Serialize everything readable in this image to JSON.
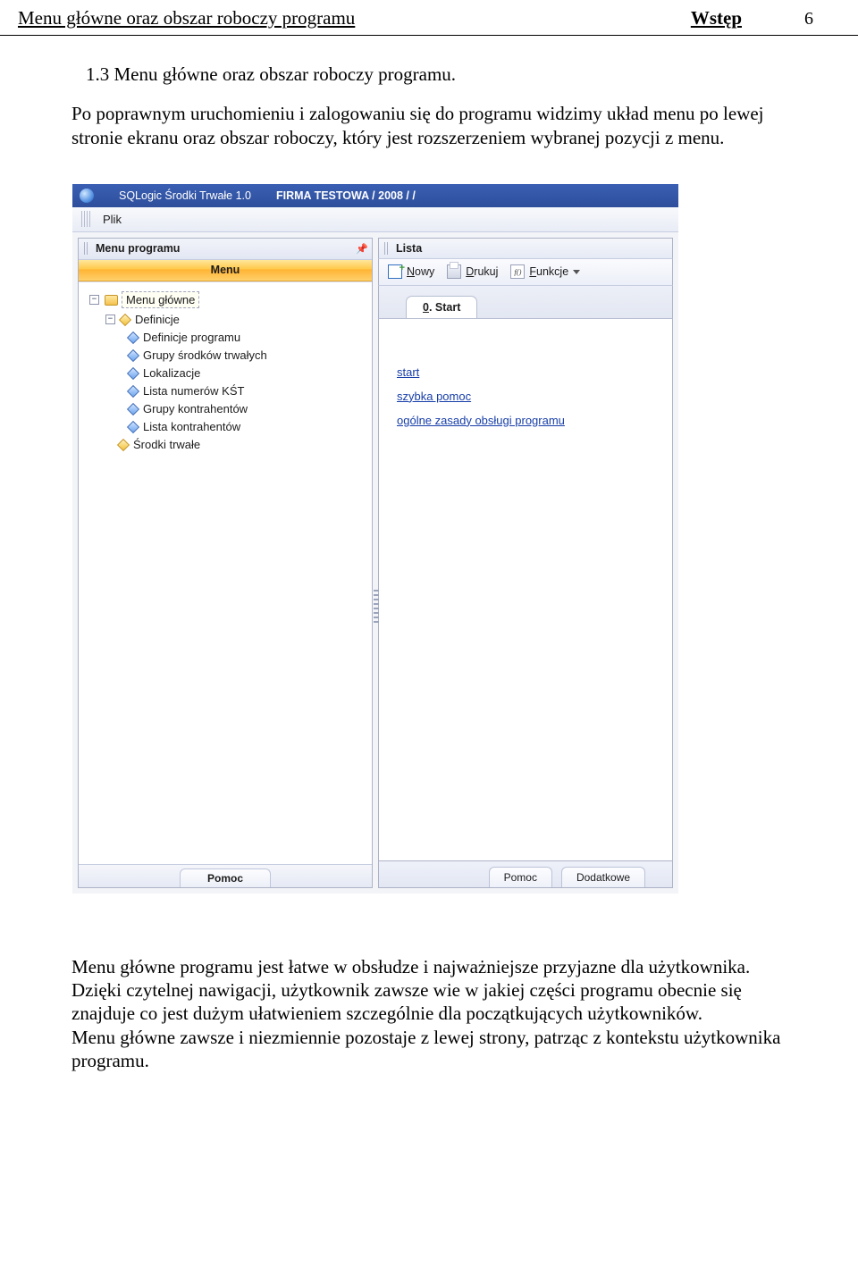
{
  "header": {
    "left": "Menu główne oraz obszar roboczy programu",
    "right_title": "Wstęp",
    "page_number": "6"
  },
  "section": {
    "heading": "1.3 Menu główne oraz obszar roboczy programu.",
    "para1": "Po poprawnym uruchomieniu i zalogowaniu się do programu widzimy układ menu po lewej stronie ekranu oraz obszar roboczy, który jest rozszerzeniem wybranej pozycji z menu."
  },
  "app": {
    "title_program": "SQLogic Środki Trwałe 1.0",
    "title_context": "FIRMA TESTOWA / 2008 /  /",
    "menubar": {
      "file": "Plik"
    },
    "sidepanel": {
      "title": "Menu programu",
      "header": "Menu",
      "bottom_tab": "Pomoc",
      "tree": {
        "root": "Menu główne",
        "definicje": "Definicje",
        "items": [
          "Definicje programu",
          "Grupy środków trwałych",
          "Lokalizacje",
          "Lista numerów KŚT",
          "Grupy kontrahentów",
          "Lista kontrahentów"
        ],
        "srodki": "Środki trwałe"
      }
    },
    "main": {
      "title": "Lista",
      "toolbar": {
        "new": "Nowy",
        "print": "Drukuj",
        "functions": "Funkcje",
        "fn_glyph": "f()"
      },
      "tab": "0. Start",
      "links": {
        "start": "start",
        "help": "szybka pomoc",
        "rules": "ogólne zasady obsługi programu"
      },
      "bottom_tabs": {
        "pomoc": "Pomoc",
        "dodatkowe": "Dodatkowe"
      }
    }
  },
  "below": {
    "para2": "Menu główne programu jest łatwe w obsłudze i najważniejsze przyjazne dla użytkownika. Dzięki czytelnej nawigacji, użytkownik zawsze wie w jakiej części programu obecnie się znajduje co jest dużym ułatwieniem szczególnie dla początkujących użytkowników.",
    "para3": "Menu główne zawsze i niezmiennie pozostaje z lewej strony, patrząc z kontekstu użytkownika programu."
  }
}
